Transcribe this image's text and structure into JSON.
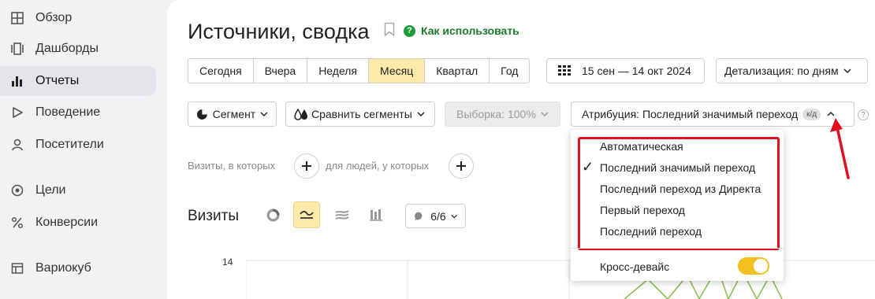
{
  "sidebar": {
    "items": [
      {
        "label": "Обзор",
        "icon": "grid-icon",
        "active": false
      },
      {
        "label": "Дашборды",
        "icon": "dashboard-icon",
        "active": false
      },
      {
        "label": "Отчеты",
        "icon": "bar-chart-icon",
        "active": true
      },
      {
        "label": "Поведение",
        "icon": "play-icon",
        "active": false
      },
      {
        "label": "Посетители",
        "icon": "user-icon",
        "active": false
      },
      {
        "label": "Цели",
        "icon": "target-icon",
        "active": false
      },
      {
        "label": "Конверсии",
        "icon": "percent-icon",
        "active": false
      },
      {
        "label": "Вариокуб",
        "icon": "table-icon",
        "active": false
      }
    ]
  },
  "header": {
    "title": "Источники, сводка",
    "howto": "Как использовать"
  },
  "periods": [
    "Сегодня",
    "Вчера",
    "Неделя",
    "Месяц",
    "Квартал",
    "Год"
  ],
  "selected_period": "Месяц",
  "date_range": "15 сен — 14 окт 2024",
  "detail": "Детализация: по дням",
  "toolbar": {
    "segment": "Сегмент",
    "compare": "Сравнить сегменты",
    "sample": "Выборка: 100%",
    "attribution": "Атрибуция: Последний значимый переход",
    "attribution_badge": "к/д",
    "help": "?"
  },
  "filters": {
    "visits_where": "Визиты, в которых",
    "people_where": "для людей, у которых"
  },
  "chart": {
    "title": "Визиты",
    "series_count": "6/6",
    "y_tick": "14"
  },
  "attribution_dropdown": {
    "options": [
      "Автоматическая",
      "Последний значимый переход",
      "Последний переход из Директа",
      "Первый переход",
      "Последний переход"
    ],
    "selected_index": 1,
    "cross_device_label": "Кросс-девайс",
    "cross_device_on": true
  },
  "colors": {
    "accent_yellow": "#fdeaa8",
    "toggle_yellow": "#f4c020",
    "highlight_red": "#e0101e",
    "howto_green": "#1a7d2c",
    "chart_line": "#8dc04f"
  }
}
